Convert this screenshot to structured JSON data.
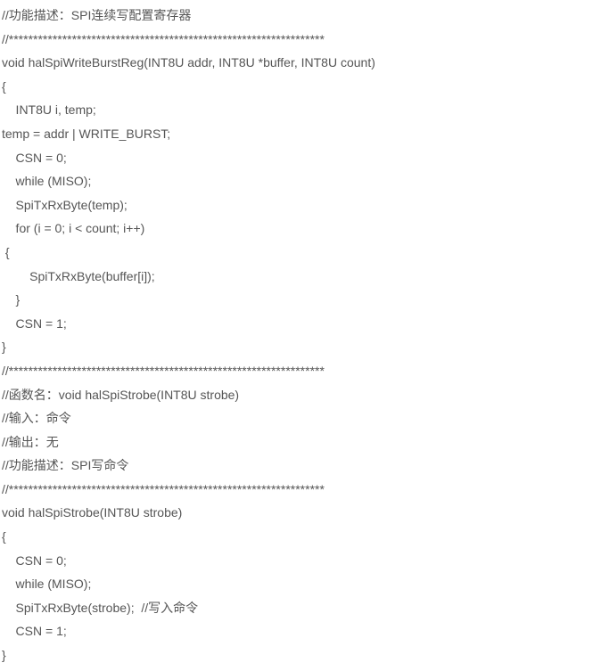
{
  "lines": [
    "//功能描述：SPI连续写配置寄存器",
    "//*****************************************************************",
    "void halSpiWriteBurstReg(INT8U addr, INT8U *buffer, INT8U count)",
    "{",
    "    INT8U i, temp;",
    "temp = addr | WRITE_BURST;",
    "    CSN = 0;",
    "    while (MISO);",
    "    SpiTxRxByte(temp);",
    "    for (i = 0; i < count; i++)",
    " {",
    "        SpiTxRxByte(buffer[i]);",
    "    }",
    "    CSN = 1;",
    "}",
    "//*****************************************************************",
    "//函数名：void halSpiStrobe(INT8U strobe)",
    "//输入：命令",
    "//输出：无",
    "//功能描述：SPI写命令",
    "//*****************************************************************",
    "void halSpiStrobe(INT8U strobe)",
    "{",
    "    CSN = 0;",
    "    while (MISO);",
    "    SpiTxRxByte(strobe);  //写入命令",
    "    CSN = 1;",
    "}"
  ]
}
